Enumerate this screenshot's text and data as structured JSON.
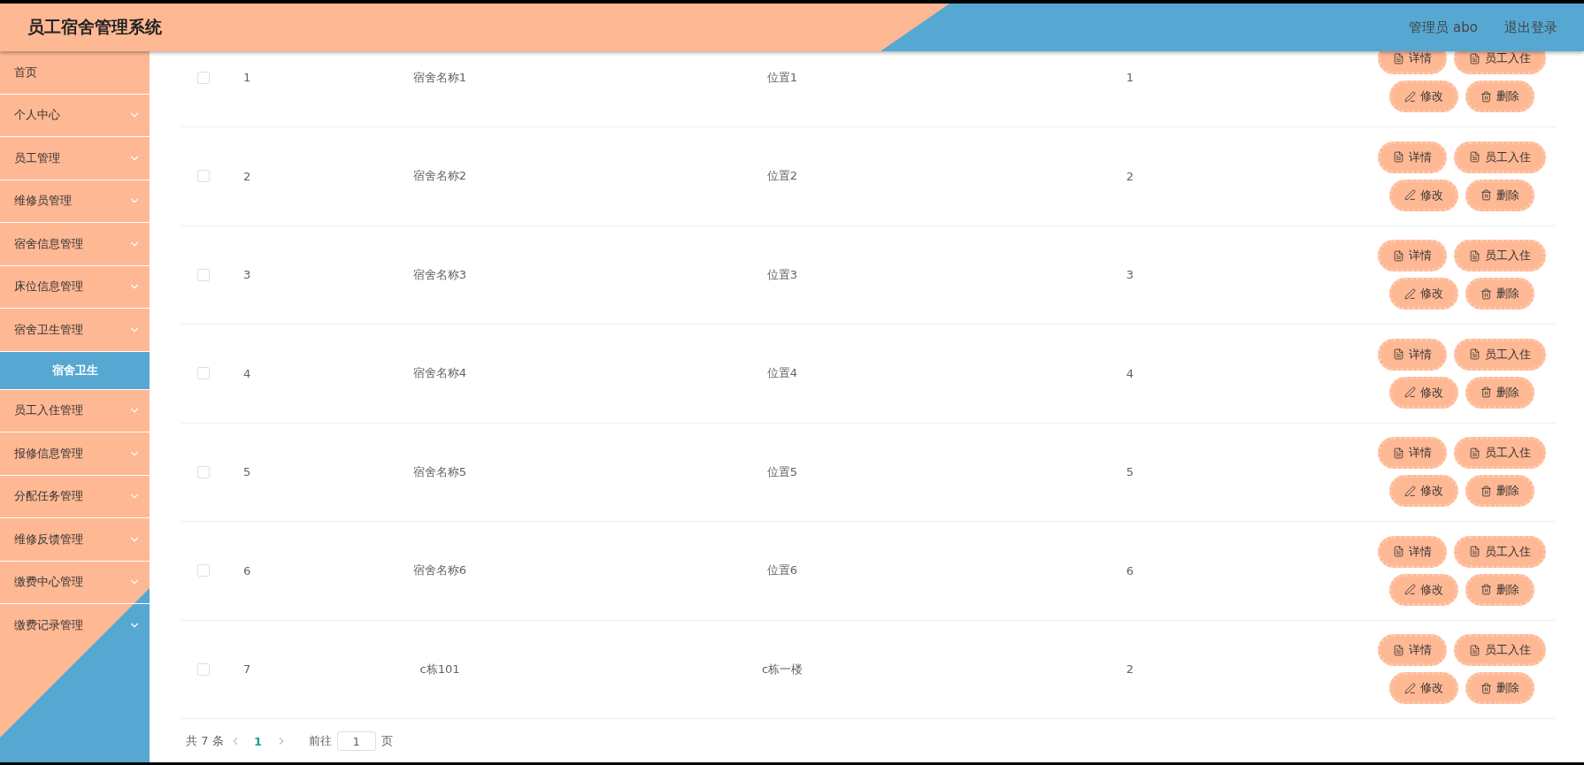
{
  "header": {
    "title": "员工宿舍管理系统",
    "user": "管理员 abo",
    "logout": "退出登录"
  },
  "sidebar": {
    "items": [
      {
        "label": "首页",
        "kind": "link"
      },
      {
        "label": "个人中心",
        "kind": "submenu"
      },
      {
        "label": "员工管理",
        "kind": "submenu"
      },
      {
        "label": "维修员管理",
        "kind": "submenu"
      },
      {
        "label": "宿舍信息管理",
        "kind": "submenu"
      },
      {
        "label": "床位信息管理",
        "kind": "submenu"
      },
      {
        "label": "宿舍卫生管理",
        "kind": "submenu",
        "children": [
          {
            "label": "宿舍卫生",
            "selected": true
          }
        ]
      },
      {
        "label": "员工入住管理",
        "kind": "submenu"
      },
      {
        "label": "报修信息管理",
        "kind": "submenu"
      },
      {
        "label": "分配任务管理",
        "kind": "submenu"
      },
      {
        "label": "维修反馈管理",
        "kind": "submenu"
      },
      {
        "label": "缴费中心管理",
        "kind": "submenu"
      },
      {
        "label": "缴费记录管理",
        "kind": "submenu"
      }
    ]
  },
  "table": {
    "rows": [
      {
        "checked": false,
        "index": "1",
        "name": "宿舍名称1",
        "location": "位置1",
        "count": "1",
        "actions": [
          {
            "kind": "detail",
            "label": "详情"
          },
          {
            "kind": "checkin",
            "label": "员工入住"
          },
          {
            "kind": "edit",
            "label": "修改"
          },
          {
            "kind": "delete",
            "label": "删除"
          }
        ]
      },
      {
        "checked": false,
        "index": "2",
        "name": "宿舍名称2",
        "location": "位置2",
        "count": "2",
        "actions": [
          {
            "kind": "detail",
            "label": "详情"
          },
          {
            "kind": "checkin",
            "label": "员工入住"
          },
          {
            "kind": "edit",
            "label": "修改"
          },
          {
            "kind": "delete",
            "label": "删除"
          }
        ]
      },
      {
        "checked": false,
        "index": "3",
        "name": "宿舍名称3",
        "location": "位置3",
        "count": "3",
        "actions": [
          {
            "kind": "detail",
            "label": "详情"
          },
          {
            "kind": "checkin",
            "label": "员工入住"
          },
          {
            "kind": "edit",
            "label": "修改"
          },
          {
            "kind": "delete",
            "label": "删除"
          }
        ]
      },
      {
        "checked": false,
        "index": "4",
        "name": "宿舍名称4",
        "location": "位置4",
        "count": "4",
        "actions": [
          {
            "kind": "detail",
            "label": "详情"
          },
          {
            "kind": "checkin",
            "label": "员工入住"
          },
          {
            "kind": "edit",
            "label": "修改"
          },
          {
            "kind": "delete",
            "label": "删除"
          }
        ]
      },
      {
        "checked": false,
        "index": "5",
        "name": "宿舍名称5",
        "location": "位置5",
        "count": "5",
        "actions": [
          {
            "kind": "detail",
            "label": "详情"
          },
          {
            "kind": "checkin",
            "label": "员工入住"
          },
          {
            "kind": "edit",
            "label": "修改"
          },
          {
            "kind": "delete",
            "label": "删除"
          }
        ]
      },
      {
        "checked": false,
        "index": "6",
        "name": "宿舍名称6",
        "location": "位置6",
        "count": "6",
        "actions": [
          {
            "kind": "detail",
            "label": "详情"
          },
          {
            "kind": "checkin",
            "label": "员工入住"
          },
          {
            "kind": "edit",
            "label": "修改"
          },
          {
            "kind": "delete",
            "label": "删除"
          }
        ]
      },
      {
        "checked": false,
        "index": "7",
        "name": "c栋101",
        "location": "c栋一楼",
        "count": "2",
        "actions": [
          {
            "kind": "detail",
            "label": "详情"
          },
          {
            "kind": "checkin",
            "label": "员工入住"
          },
          {
            "kind": "edit",
            "label": "修改"
          },
          {
            "kind": "delete",
            "label": "删除"
          }
        ]
      }
    ]
  },
  "pagination": {
    "total": "共 7 条",
    "pages": [
      {
        "label": "1",
        "selected": true
      }
    ],
    "goto_label": "前往",
    "goto_value": "1",
    "suffix": "页"
  }
}
